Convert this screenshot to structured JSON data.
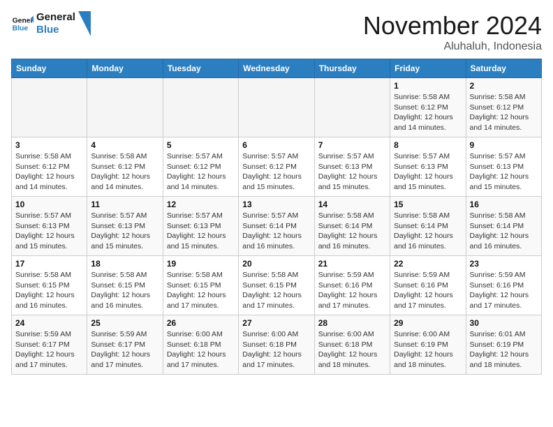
{
  "header": {
    "logo_line1": "General",
    "logo_line2": "Blue",
    "month": "November 2024",
    "location": "Aluhaluh, Indonesia"
  },
  "weekdays": [
    "Sunday",
    "Monday",
    "Tuesday",
    "Wednesday",
    "Thursday",
    "Friday",
    "Saturday"
  ],
  "weeks": [
    [
      {
        "day": "",
        "info": ""
      },
      {
        "day": "",
        "info": ""
      },
      {
        "day": "",
        "info": ""
      },
      {
        "day": "",
        "info": ""
      },
      {
        "day": "",
        "info": ""
      },
      {
        "day": "1",
        "info": "Sunrise: 5:58 AM\nSunset: 6:12 PM\nDaylight: 12 hours\nand 14 minutes."
      },
      {
        "day": "2",
        "info": "Sunrise: 5:58 AM\nSunset: 6:12 PM\nDaylight: 12 hours\nand 14 minutes."
      }
    ],
    [
      {
        "day": "3",
        "info": "Sunrise: 5:58 AM\nSunset: 6:12 PM\nDaylight: 12 hours\nand 14 minutes."
      },
      {
        "day": "4",
        "info": "Sunrise: 5:58 AM\nSunset: 6:12 PM\nDaylight: 12 hours\nand 14 minutes."
      },
      {
        "day": "5",
        "info": "Sunrise: 5:57 AM\nSunset: 6:12 PM\nDaylight: 12 hours\nand 14 minutes."
      },
      {
        "day": "6",
        "info": "Sunrise: 5:57 AM\nSunset: 6:12 PM\nDaylight: 12 hours\nand 15 minutes."
      },
      {
        "day": "7",
        "info": "Sunrise: 5:57 AM\nSunset: 6:13 PM\nDaylight: 12 hours\nand 15 minutes."
      },
      {
        "day": "8",
        "info": "Sunrise: 5:57 AM\nSunset: 6:13 PM\nDaylight: 12 hours\nand 15 minutes."
      },
      {
        "day": "9",
        "info": "Sunrise: 5:57 AM\nSunset: 6:13 PM\nDaylight: 12 hours\nand 15 minutes."
      }
    ],
    [
      {
        "day": "10",
        "info": "Sunrise: 5:57 AM\nSunset: 6:13 PM\nDaylight: 12 hours\nand 15 minutes."
      },
      {
        "day": "11",
        "info": "Sunrise: 5:57 AM\nSunset: 6:13 PM\nDaylight: 12 hours\nand 15 minutes."
      },
      {
        "day": "12",
        "info": "Sunrise: 5:57 AM\nSunset: 6:13 PM\nDaylight: 12 hours\nand 15 minutes."
      },
      {
        "day": "13",
        "info": "Sunrise: 5:57 AM\nSunset: 6:14 PM\nDaylight: 12 hours\nand 16 minutes."
      },
      {
        "day": "14",
        "info": "Sunrise: 5:58 AM\nSunset: 6:14 PM\nDaylight: 12 hours\nand 16 minutes."
      },
      {
        "day": "15",
        "info": "Sunrise: 5:58 AM\nSunset: 6:14 PM\nDaylight: 12 hours\nand 16 minutes."
      },
      {
        "day": "16",
        "info": "Sunrise: 5:58 AM\nSunset: 6:14 PM\nDaylight: 12 hours\nand 16 minutes."
      }
    ],
    [
      {
        "day": "17",
        "info": "Sunrise: 5:58 AM\nSunset: 6:15 PM\nDaylight: 12 hours\nand 16 minutes."
      },
      {
        "day": "18",
        "info": "Sunrise: 5:58 AM\nSunset: 6:15 PM\nDaylight: 12 hours\nand 16 minutes."
      },
      {
        "day": "19",
        "info": "Sunrise: 5:58 AM\nSunset: 6:15 PM\nDaylight: 12 hours\nand 17 minutes."
      },
      {
        "day": "20",
        "info": "Sunrise: 5:58 AM\nSunset: 6:15 PM\nDaylight: 12 hours\nand 17 minutes."
      },
      {
        "day": "21",
        "info": "Sunrise: 5:59 AM\nSunset: 6:16 PM\nDaylight: 12 hours\nand 17 minutes."
      },
      {
        "day": "22",
        "info": "Sunrise: 5:59 AM\nSunset: 6:16 PM\nDaylight: 12 hours\nand 17 minutes."
      },
      {
        "day": "23",
        "info": "Sunrise: 5:59 AM\nSunset: 6:16 PM\nDaylight: 12 hours\nand 17 minutes."
      }
    ],
    [
      {
        "day": "24",
        "info": "Sunrise: 5:59 AM\nSunset: 6:17 PM\nDaylight: 12 hours\nand 17 minutes."
      },
      {
        "day": "25",
        "info": "Sunrise: 5:59 AM\nSunset: 6:17 PM\nDaylight: 12 hours\nand 17 minutes."
      },
      {
        "day": "26",
        "info": "Sunrise: 6:00 AM\nSunset: 6:18 PM\nDaylight: 12 hours\nand 17 minutes."
      },
      {
        "day": "27",
        "info": "Sunrise: 6:00 AM\nSunset: 6:18 PM\nDaylight: 12 hours\nand 17 minutes."
      },
      {
        "day": "28",
        "info": "Sunrise: 6:00 AM\nSunset: 6:18 PM\nDaylight: 12 hours\nand 18 minutes."
      },
      {
        "day": "29",
        "info": "Sunrise: 6:00 AM\nSunset: 6:19 PM\nDaylight: 12 hours\nand 18 minutes."
      },
      {
        "day": "30",
        "info": "Sunrise: 6:01 AM\nSunset: 6:19 PM\nDaylight: 12 hours\nand 18 minutes."
      }
    ]
  ]
}
